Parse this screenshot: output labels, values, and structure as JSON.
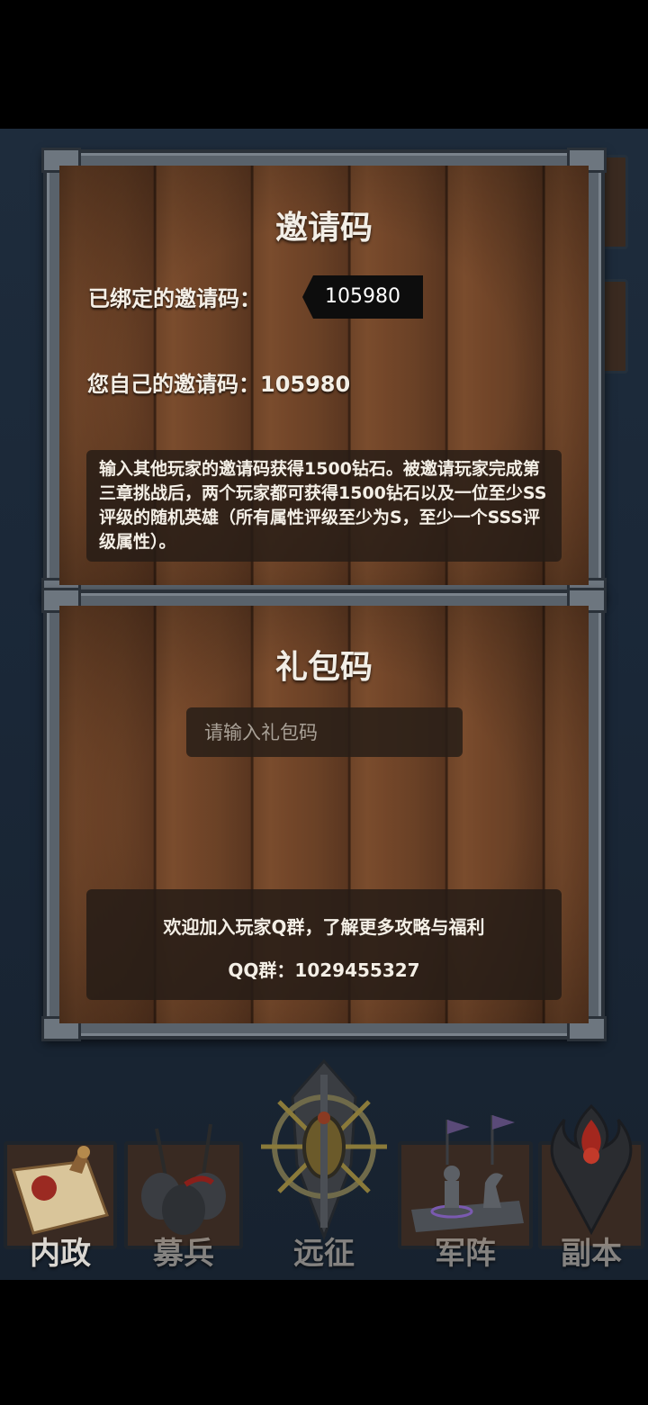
{
  "invite": {
    "title": "邀请码",
    "bound_label": "已绑定的邀请码：",
    "bound_value": "105980",
    "own_label": "您自己的邀请码：",
    "own_value": "105980",
    "description": "输入其他玩家的邀请码获得1500钻石。被邀请玩家完成第三章挑战后，两个玩家都可获得1500钻石以及一位至少SS评级的随机英雄（所有属性评级至少为S，至少一个SSS评级属性）。"
  },
  "gift": {
    "title": "礼包码",
    "input_placeholder": "请输入礼包码",
    "qq_text": "欢迎加入玩家Q群，了解更多攻略与福利",
    "qq_group_label": "QQ群：",
    "qq_group_number": "1029455327"
  },
  "nav": {
    "items": [
      {
        "label": "内政",
        "icon": "scroll-seal-icon"
      },
      {
        "label": "募兵",
        "icon": "helmets-icon"
      },
      {
        "label": "远征",
        "icon": "sword-emblem-icon"
      },
      {
        "label": "军阵",
        "icon": "chess-pieces-icon"
      },
      {
        "label": "副本",
        "icon": "dark-crest-icon"
      }
    ]
  }
}
